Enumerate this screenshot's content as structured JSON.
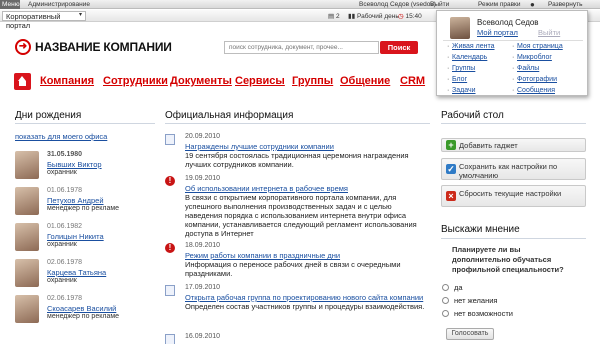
{
  "admin_bar": {
    "menu_label": "Меню",
    "admin_label": "Администрирование",
    "user_label": "Всеволод Седов (vsedov)",
    "logout_label": "Выйти",
    "edit_mode_label": "Режим правки",
    "expand_label": "Развернуть"
  },
  "top_bar": {
    "portal_select_value": "Корпоративный портал",
    "counter_value": "2",
    "workday_label": "Рабочий день",
    "time_value": "15:40"
  },
  "header": {
    "company_name": "НАЗВАНИЕ КОМПАНИИ",
    "search_placeholder": "поиск сотрудника, документ, прочее...",
    "search_button": "Поиск"
  },
  "nav": {
    "items": [
      "Компания",
      "Сотрудники",
      "Документы",
      "Сервисы",
      "Группы",
      "Общение",
      "CRM"
    ]
  },
  "birthdays": {
    "title": "Дни рождения",
    "office_link": "показать для моего офиса",
    "items": [
      {
        "date": "31.05.1980",
        "name": "Бывших Виктор",
        "position": "охранник"
      },
      {
        "date": "01.06.1978",
        "name": "Петухов Андрей",
        "position": "менеджер по рекламе"
      },
      {
        "date": "01.06.1982",
        "name": "Голицын Никита",
        "position": "охранник"
      },
      {
        "date": "02.06.1978",
        "name": "Карцева Татьяна",
        "position": "охранник"
      },
      {
        "date": "02.06.1978",
        "name": "Скоасарев Василий",
        "position": "менеджер по рекламе"
      }
    ]
  },
  "official": {
    "title": "Официальная информация",
    "items": [
      {
        "date": "20.09.2010",
        "title": "Награждены лучшие сотрудники компании",
        "text": "19 сентября состоялась традиционная церемония награждения лучших сотрудников компании.",
        "icon": "document-icon"
      },
      {
        "date": "19.09.2010",
        "title": "Об использовании интернета в рабочее время",
        "text": "В связи с открытием корпоративного портала компании, для успешного выполнения производственных задач и с целью наведения порядка с использованием интернета внутри офиса компании, устанавливается следующий регламент использования доступа в Интернет",
        "icon": "alert-icon"
      },
      {
        "date": "18.09.2010",
        "title": "Режим работы компании в праздничные дни",
        "text": "Информация о переносе рабочих дней в связи с очередными праздниками.",
        "icon": "alert-icon"
      },
      {
        "date": "17.09.2010",
        "title": "Открыта рабочая группа по проектированию нового сайта компании",
        "text": "Определен состав участников группы и процедуры взаимодействия.",
        "icon": "document-icon"
      },
      {
        "date": "16.09.2010",
        "title": "",
        "text": "",
        "icon": "document-icon"
      }
    ]
  },
  "desktop": {
    "title": "Рабочий стол",
    "buttons": [
      {
        "label": "Добавить гаджет",
        "color": "#3a9a2a"
      },
      {
        "label": "Сохранить как настройки по умолчанию",
        "color": "#2f7bc6"
      },
      {
        "label": "Сбросить текущие настройки",
        "color": "#cc2a1a"
      }
    ]
  },
  "poll": {
    "title": "Выскажи мнение",
    "question": "Планируете ли вы дополнительно обучаться профильной специальности?",
    "options": [
      "да",
      "нет желания",
      "нет возможности"
    ],
    "vote_button": "Голосовать"
  },
  "user_popup": {
    "name": "Всеволод Седов",
    "my_portal": "Мой портал",
    "logout": "Выйти",
    "links_left": [
      "Живая лента",
      "Календарь",
      "Группы",
      "Блог",
      "Задачи"
    ],
    "links_right": [
      "Моя страница",
      "Микроблог",
      "Файлы",
      "Фотографии",
      "Сообщения"
    ]
  },
  "colors": {
    "brand_red": "#d9141c",
    "link_blue": "#1a4fa0"
  }
}
